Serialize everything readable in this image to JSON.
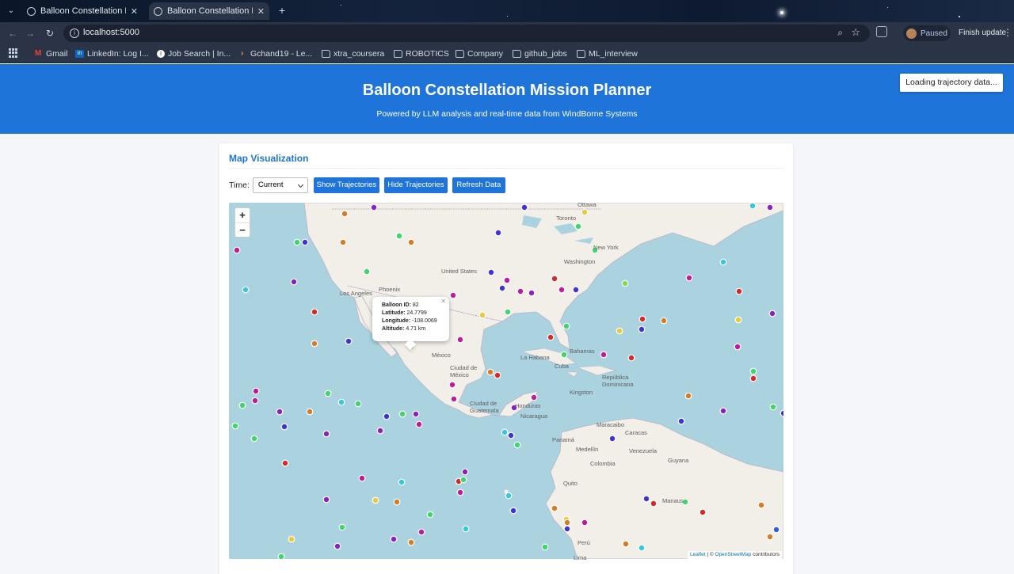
{
  "browser": {
    "tabs": [
      {
        "title": "Balloon Constellation Mission Planner"
      },
      {
        "title": "Balloon Constellation Mission Planner"
      }
    ],
    "url": "localhost:5000",
    "profile_status": "Paused",
    "update_label": "Finish update",
    "bookmarks": [
      "Gmail",
      "LinkedIn: Log I...",
      "Job Search | In...",
      "Gchand19 - Le...",
      "xtra_coursera",
      "ROBOTICS",
      "Company",
      "github_jobs",
      "ML_interview"
    ]
  },
  "header": {
    "title": "Balloon Constellation Mission Planner",
    "subtitle": "Powered by LLM analysis and real-time data from WindBorne Systems",
    "status_button": "Loading trajectory data..."
  },
  "map_section": {
    "title": "Map Visualization",
    "time_label": "Time:",
    "time_value": "Current",
    "buttons": {
      "show": "Show Trajectories",
      "hide": "Hide Trajectories",
      "refresh": "Refresh Data"
    },
    "zoom_in": "+",
    "zoom_out": "−",
    "attribution": {
      "leaflet": "Leaflet",
      "sep": " | © ",
      "osm": "OpenStreetMap",
      "tail": " contributors"
    },
    "place_labels": [
      "Ottawa",
      "Toronto",
      "New York",
      "Washington",
      "United States",
      "Phoenix",
      "Los Angeles",
      "México",
      "Ciudad de México",
      "La Habana",
      "Cuba",
      "Bahamas",
      "República Dominicana",
      "Kingston",
      "Ciudad de Guatemala",
      "Honduras",
      "Nicaragua",
      "Panamá",
      "Maracaibo",
      "Caracas",
      "Venezuela",
      "Medellín",
      "Colombia",
      "Guyana",
      "Quito",
      "Manaus",
      "Perú",
      "Lima"
    ],
    "popup": {
      "id_label": "Balloon ID:",
      "id": "82",
      "lat_label": "Latitude:",
      "lat": "24.7799",
      "lon_label": "Longitude:",
      "lon": "-108.0069",
      "alt_label": "Altitude:",
      "alt": "4.71 km"
    }
  },
  "colors": {
    "header_blue": "#1f74da",
    "marker_colors": [
      "#d67b25",
      "#8a1fc2",
      "#3d33d6",
      "#7ed957",
      "#c01a9b",
      "#33c7e0",
      "#d62828",
      "#3dd66a",
      "#e8c93a",
      "#2a5fd6"
    ]
  }
}
